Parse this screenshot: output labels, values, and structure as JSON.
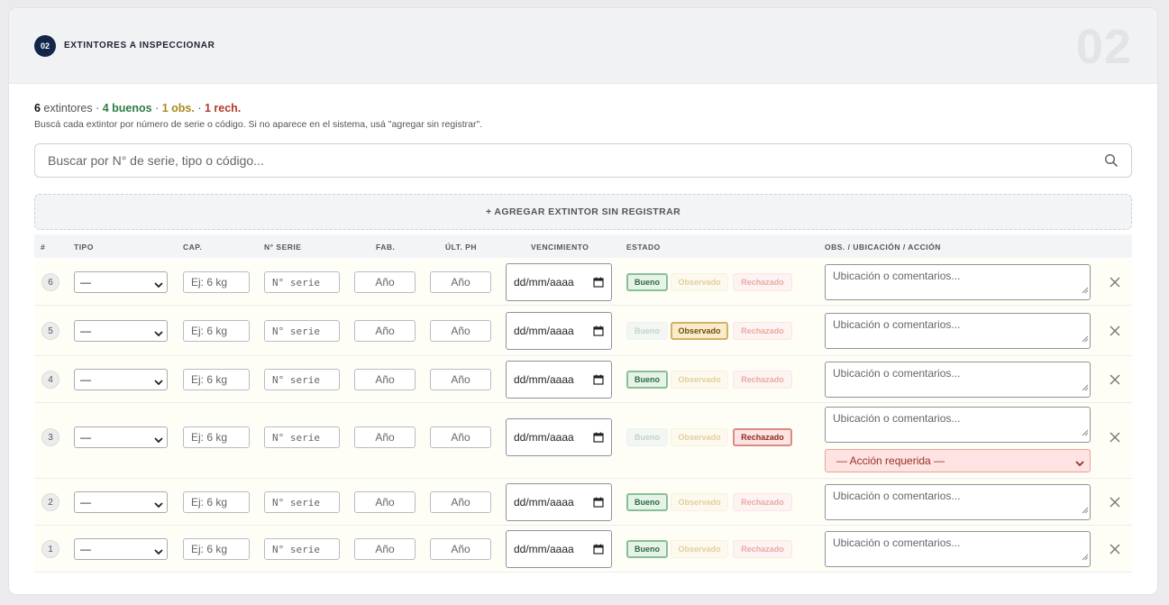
{
  "section": {
    "step_badge": "02",
    "title": "EXTINTORES A INSPECCIONAR",
    "big_number": "02"
  },
  "summary": {
    "total": "6",
    "total_label": " extintores",
    "sep": " · ",
    "good": "4 buenos",
    "obs": "1 obs.",
    "rej": "1 rech.",
    "hint": "Buscá cada extintor por número de serie o código. Si no aparece en el sistema, usá \"agregar sin registrar\"."
  },
  "search": {
    "placeholder": "Buscar por N° de serie, tipo o código..."
  },
  "add_button": "+ AGREGAR EXTINTOR SIN REGISTRAR",
  "columns": [
    "#",
    "TIPO",
    "CAP.",
    "N° SERIE",
    "FAB.",
    "ÚLT. PH",
    "VENCIMIENTO",
    "ESTADO",
    "OBS. / UBICACIÓN / ACCIÓN"
  ],
  "form": {
    "tipo_default": "—",
    "cap_placeholder": "Ej: 6 kg",
    "serie_placeholder": "N° serie",
    "year_placeholder": "Año",
    "date_placeholder": "dd/mm/aaaa",
    "state_good": "Bueno",
    "state_obs": "Observado",
    "state_rej": "Rechazado",
    "obs_placeholder": "Ubicación o comentarios...",
    "action_placeholder": "— Acción requerida —"
  },
  "rows": [
    {
      "num": "6",
      "estado": "Bueno"
    },
    {
      "num": "5",
      "estado": "Observado"
    },
    {
      "num": "4",
      "estado": "Bueno"
    },
    {
      "num": "3",
      "estado": "Rechazado"
    },
    {
      "num": "2",
      "estado": "Bueno"
    },
    {
      "num": "1",
      "estado": "Bueno"
    }
  ],
  "colors": {
    "badge": "#12264a",
    "good": "#2e7d43",
    "obs": "#a98a1a",
    "rej": "#b23a2a"
  },
  "icons": {
    "search": "search-icon",
    "delete": "close-icon",
    "calendar": "calendar-icon",
    "select": "chevron-down-icon"
  }
}
